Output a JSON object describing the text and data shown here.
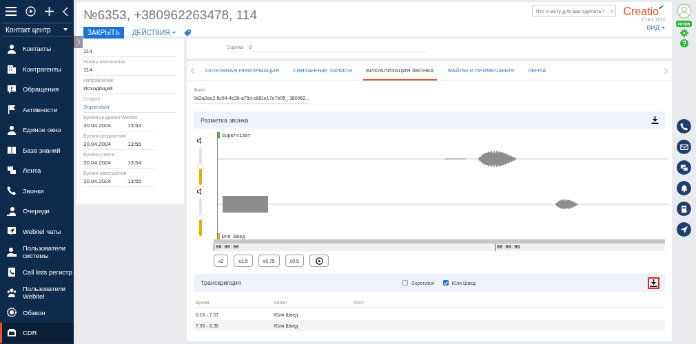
{
  "sidebar": {
    "section": "Контакт центр",
    "items": [
      {
        "label": "Контакты",
        "selected": false
      },
      {
        "label": "Контрагенты",
        "selected": false
      },
      {
        "label": "Обращения",
        "selected": false
      },
      {
        "label": "Активности",
        "selected": false
      },
      {
        "label": "Единое окно",
        "selected": false
      },
      {
        "label": "База знаний",
        "selected": false
      },
      {
        "label": "Лента",
        "selected": false
      },
      {
        "label": "Звонки",
        "selected": false
      },
      {
        "label": "Очереди",
        "selected": false
      },
      {
        "label": "Webitel чаты",
        "selected": false
      },
      {
        "label": "Пользователи системы",
        "selected": false
      },
      {
        "label": "Call lists регистр",
        "selected": false
      },
      {
        "label": "Пользователи Webitel",
        "selected": false
      },
      {
        "label": "Обзвон",
        "selected": false
      },
      {
        "label": "CDR",
        "selected": true
      }
    ]
  },
  "header": {
    "title": "№6353, +380962263478, 114",
    "close_button": "ЗАКРЫТЬ",
    "actions_button": "ДЕЙСТВИЯ",
    "search": {
      "placeholder": "Что я могу для вас сделать?"
    },
    "logo": "Creatio",
    "version": "7.18.4.1532",
    "view_button": "ВИД"
  },
  "details": {
    "fields": [
      {
        "kind": "text",
        "value": "114"
      },
      {
        "kind": "text",
        "label": "Номер назначения",
        "value": "114"
      },
      {
        "kind": "text",
        "label": "Направление",
        "value": "Исходящий"
      },
      {
        "kind": "link",
        "label": "Создал",
        "value": "Supervisor"
      },
      {
        "kind": "datetime",
        "label": "Время создания Webitel",
        "date": "30.04.2024",
        "time": "13:54"
      },
      {
        "kind": "datetime",
        "label": "Время соединения",
        "date": "30.04.2024",
        "time": "13:55"
      },
      {
        "kind": "datetime",
        "label": "Время ответа",
        "date": "30.04.2024",
        "time": "13:54"
      },
      {
        "kind": "datetime",
        "label": "Время завершения",
        "date": "30.04.2024",
        "time": "13:55"
      }
    ]
  },
  "rating": {
    "label": "Оценка",
    "value": "0"
  },
  "tabs": [
    {
      "label": "ОСНОВНАЯ ИНФОРМАЦИЯ",
      "selected": false
    },
    {
      "label": "СВЯЗАННЫЕ ЗАПИСИ",
      "selected": false
    },
    {
      "label": "ВИЗУАЛИЗАЦИЯ ЗВОНКА",
      "selected": true
    },
    {
      "label": "ФАЙЛЫ И ПРИМЕЧАНИЯ",
      "selected": false
    },
    {
      "label": "ЛЕНТА",
      "selected": false
    }
  ],
  "file": {
    "label": "Файл",
    "value": "9d2a2ee2-5c94-4e36-a75d-c681e17e7b05_ 380962..."
  },
  "markup": {
    "title": "Разметка звонка",
    "channels": [
      {
        "name": "Supervisor",
        "color": "#4caf50",
        "level": 0.5
      },
      {
        "name": "Юля Швед",
        "color": "#f5a800",
        "level": 0.5
      }
    ],
    "time_labels": [
      "00:00:00",
      "00:00:05"
    ],
    "speeds": [
      "x2",
      "x1.5",
      "x0.75",
      "x0.5"
    ]
  },
  "transcription": {
    "title": "Транскрипция",
    "filters": [
      {
        "label": "Supervisor",
        "checked": false
      },
      {
        "label": "Юля Швед",
        "checked": true
      }
    ],
    "download_highlighted": true,
    "columns": [
      "Время",
      "Канал",
      "Текст"
    ],
    "rows": [
      {
        "time": "0.16 - 7.07",
        "channel": "Юля Швед"
      },
      {
        "time": "7.96 - 8.36",
        "channel": "Юля Швед"
      }
    ]
  },
  "rail": {
    "status": "готов"
  }
}
